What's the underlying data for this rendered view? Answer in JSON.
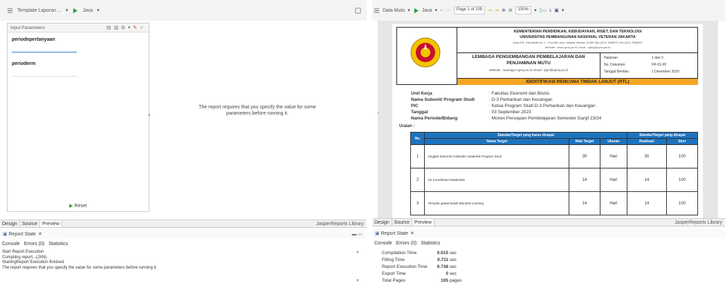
{
  "left": {
    "toolbar": {
      "tab_label": "Template Laporan ...",
      "lang_label": "Java"
    },
    "params": {
      "title": "Input Parameters",
      "fields": [
        {
          "label": "periodepertanyaan",
          "value": ""
        },
        {
          "label": "perioderm",
          "value": ""
        }
      ],
      "reset_label": "Reset"
    },
    "message": "The report requires that you specify the value for some parameters before running it.",
    "tabs": [
      "Design",
      "Source",
      "Preview"
    ],
    "library_label": "JasperReports Library",
    "view_title": "Report State",
    "subtabs": [
      "Console",
      "Errors (0)",
      "Statistics"
    ],
    "console_lines": [
      "Start Report Execution",
      "Compiling report...(JXN)",
      "StartingReport Execution finished.",
      "The report requires that you specify the value for some parameters before running it."
    ]
  },
  "right": {
    "toolbar": {
      "source_label": "Data Mutu",
      "lang_label": "Java",
      "page_label": "Page 1 of 105",
      "zoom_label": "150%"
    },
    "report": {
      "header_lines": [
        "KEMENTERIAN PENDIDIKAN, KEBUDAYAAN, RISET, DAN TEKNOLOGI",
        "UNIVERSITAS PEMBANGUNAN NASIONAL VETERAN JAKARTA",
        "Jalan RS. Fatmawati No. 1 - Pondok Labu, Jakarta Selatan 12450 Telp (021) 7656971 Fax (021) 7656904",
        "Website : www.upnvj.ac.id, Email : upnvj@upnvj.ac.id"
      ],
      "lpm_lines": [
        "LEMBAGA PENGEMBANGAN PEMBELAJARAN DAN",
        "PENJAMINAN MUTU"
      ],
      "lpm_site": "Website : www.lpjm.upnvj.ac.id, Email : lpjm@upnvj.ac.id",
      "meta": [
        {
          "k": "Halaman",
          "v": "1   dari   3"
        },
        {
          "k": "No. Dokumen",
          "v": "FR-01-00"
        },
        {
          "k": "Tanggal Berlaku",
          "v": "1 Desember 2020"
        }
      ],
      "banner": "IDENTIFIKASI RENCANA TINDAK LANJUT (RTL)",
      "info": [
        {
          "k": "Unit Kerja",
          "v": ": Fakultas Ekonomi dan Bisnis"
        },
        {
          "k": "Nama Subunit/ Program Studi",
          "v": ": D-3 Perbankan dan Keuangan"
        },
        {
          "k": "PIC",
          "v": ": Ketua Program Studi D-3 Perbankan dan Keuangan"
        },
        {
          "k": "Tanggal",
          "v": ": 03 September 2023"
        },
        {
          "k": "Nama Periode/Bidang",
          "v": ": Monev Persiapan Pembelajaran Semester Ganjil 23/24"
        }
      ],
      "uraian": "Uraian :",
      "table": {
        "head_no": "No.",
        "group1": "Standar/Target yang harus dicapai",
        "group2": "Standar/Target yang dicapai",
        "cols": [
          "Nama Target",
          "Nilai Target",
          "Ukuran",
          "Realisasi",
          "Skor"
        ],
        "rows": [
          {
            "no": "1",
            "name": "Unggah Dokumen Kalender Akademik Program Studi",
            "target": "30",
            "unit": "Hari",
            "real": "30",
            "score": "100"
          },
          {
            "no": "2",
            "name": "SK Koordinator Matakuliah",
            "target": "14",
            "unit": "Hari",
            "real": "14",
            "score": "100"
          },
          {
            "no": "3",
            "name": "Tersedia jadwal kuliah Blended Learning",
            "target": "14",
            "unit": "Hari",
            "real": "14",
            "score": "100"
          }
        ]
      }
    },
    "tabs": [
      "Design",
      "Source",
      "Preview"
    ],
    "library_label": "JasperReports Library",
    "view_title": "Report State",
    "subtabs": [
      "Console",
      "Errors (0)",
      "Statistics"
    ],
    "stats": [
      {
        "k": "Compilation Time",
        "v": "0.015",
        "u": "sec"
      },
      {
        "k": "Filling Time",
        "v": "0.711",
        "u": "sec"
      },
      {
        "k": "Report Execution Time",
        "v": "0.738",
        "u": "sec"
      },
      {
        "k": "Export Time",
        "v": "0",
        "u": "sec"
      },
      {
        "k": "Total Pages",
        "v": "105",
        "u": "pages"
      }
    ]
  }
}
